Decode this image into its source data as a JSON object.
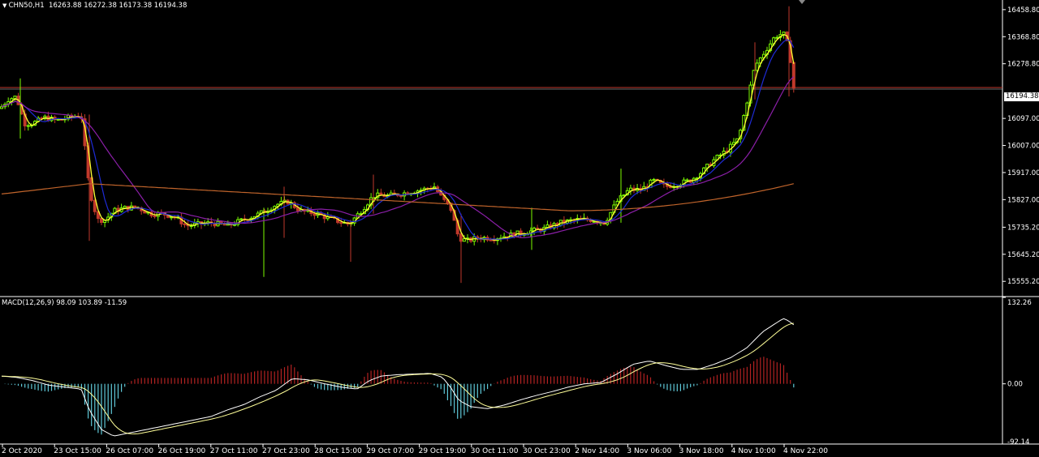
{
  "header": {
    "symbol": "CHN50,H1",
    "ohlc": "16263.88 16272.38 16173.38 16194.38",
    "dropdown_icon": "triangle-down-icon"
  },
  "macd": {
    "label": "MACD(12,26,9) 98.09 103.89 -11.59",
    "axis_labels": [
      "132.26",
      "0.00",
      "-92.14"
    ]
  },
  "price_axis": {
    "labels": [
      "16458.80",
      "16368.80",
      "16278.80",
      "16097.00",
      "16007.00",
      "15917.00",
      "15827.00",
      "15735.20",
      "15645.20",
      "15555.20"
    ],
    "current_price": "16194.38"
  },
  "time_axis": {
    "labels": [
      "2 Oct 2020",
      "23 Oct 15:00",
      "26 Oct 07:00",
      "26 Oct 19:00",
      "27 Oct 11:00",
      "27 Oct 23:00",
      "28 Oct 15:00",
      "29 Oct 07:00",
      "29 Oct 19:00",
      "30 Oct 11:00",
      "30 Oct 23:00",
      "2 Nov 14:00",
      "3 Nov 06:00",
      "3 Nov 18:00",
      "4 Nov 10:00",
      "4 Nov 22:00"
    ]
  },
  "colors": {
    "background": "#000000",
    "bull_candle": "#7CFC00",
    "bear_candle": "#C0392B",
    "ma_fast": "#FFFF33",
    "ma_mid": "#1E2BD6",
    "ma_slow": "#8B1FA8",
    "ma_long": "#C0642B",
    "macd_pos": "#B22222",
    "macd_neg": "#5FC8D8",
    "axis": "#FFFFFF",
    "price_line": "#C0392B"
  },
  "chart_data": {
    "type": "candlestick",
    "price_range": [
      15510,
      16480
    ],
    "macd_range": [
      -92.14,
      132.26
    ],
    "price_path": [
      [
        0,
        16130
      ],
      [
        10,
        16160
      ],
      [
        20,
        16170
      ],
      [
        30,
        16080
      ],
      [
        40,
        16080
      ],
      [
        55,
        16100
      ],
      [
        70,
        16090
      ],
      [
        85,
        16100
      ],
      [
        100,
        16110
      ],
      [
        110,
        15860
      ],
      [
        120,
        15760
      ],
      [
        130,
        15760
      ],
      [
        140,
        15790
      ],
      [
        155,
        15800
      ],
      [
        170,
        15800
      ],
      [
        185,
        15780
      ],
      [
        200,
        15780
      ],
      [
        215,
        15770
      ],
      [
        230,
        15740
      ],
      [
        245,
        15745
      ],
      [
        260,
        15750
      ],
      [
        280,
        15740
      ],
      [
        300,
        15760
      ],
      [
        320,
        15780
      ],
      [
        340,
        15810
      ],
      [
        355,
        15820
      ],
      [
        370,
        15790
      ],
      [
        390,
        15780
      ],
      [
        410,
        15760
      ],
      [
        430,
        15745
      ],
      [
        445,
        15790
      ],
      [
        460,
        15840
      ],
      [
        480,
        15840
      ],
      [
        500,
        15850
      ],
      [
        520,
        15860
      ],
      [
        535,
        15870
      ],
      [
        545,
        15830
      ],
      [
        555,
        15800
      ],
      [
        565,
        15700
      ],
      [
        575,
        15690
      ],
      [
        590,
        15700
      ],
      [
        610,
        15700
      ],
      [
        630,
        15710
      ],
      [
        650,
        15720
      ],
      [
        670,
        15730
      ],
      [
        690,
        15750
      ],
      [
        710,
        15760
      ],
      [
        730,
        15760
      ],
      [
        745,
        15750
      ],
      [
        760,
        15820
      ],
      [
        775,
        15860
      ],
      [
        790,
        15860
      ],
      [
        805,
        15890
      ],
      [
        820,
        15870
      ],
      [
        835,
        15880
      ],
      [
        850,
        15890
      ],
      [
        865,
        15920
      ],
      [
        880,
        15960
      ],
      [
        895,
        15990
      ],
      [
        910,
        16030
      ],
      [
        920,
        16150
      ],
      [
        930,
        16270
      ],
      [
        945,
        16330
      ],
      [
        955,
        16370
      ],
      [
        965,
        16380
      ],
      [
        972,
        16330
      ],
      [
        978,
        16194
      ]
    ],
    "macd_path": [
      [
        0,
        12
      ],
      [
        20,
        10
      ],
      [
        40,
        5
      ],
      [
        60,
        -2
      ],
      [
        80,
        -5
      ],
      [
        100,
        -8
      ],
      [
        110,
        -40
      ],
      [
        125,
        -70
      ],
      [
        140,
        -80
      ],
      [
        160,
        -75
      ],
      [
        180,
        -70
      ],
      [
        200,
        -65
      ],
      [
        220,
        -60
      ],
      [
        240,
        -55
      ],
      [
        260,
        -50
      ],
      [
        280,
        -40
      ],
      [
        300,
        -32
      ],
      [
        320,
        -20
      ],
      [
        340,
        -10
      ],
      [
        360,
        8
      ],
      [
        380,
        6
      ],
      [
        400,
        0
      ],
      [
        420,
        -5
      ],
      [
        440,
        -8
      ],
      [
        455,
        5
      ],
      [
        470,
        12
      ],
      [
        490,
        14
      ],
      [
        510,
        15
      ],
      [
        530,
        16
      ],
      [
        545,
        10
      ],
      [
        555,
        -5
      ],
      [
        565,
        -25
      ],
      [
        580,
        -35
      ],
      [
        600,
        -38
      ],
      [
        620,
        -33
      ],
      [
        640,
        -25
      ],
      [
        660,
        -18
      ],
      [
        680,
        -12
      ],
      [
        700,
        -5
      ],
      [
        720,
        0
      ],
      [
        740,
        2
      ],
      [
        760,
        15
      ],
      [
        780,
        30
      ],
      [
        800,
        35
      ],
      [
        820,
        28
      ],
      [
        840,
        22
      ],
      [
        860,
        22
      ],
      [
        880,
        30
      ],
      [
        900,
        40
      ],
      [
        920,
        55
      ],
      [
        940,
        80
      ],
      [
        955,
        92
      ],
      [
        965,
        100
      ],
      [
        972,
        96
      ],
      [
        978,
        90
      ]
    ]
  }
}
